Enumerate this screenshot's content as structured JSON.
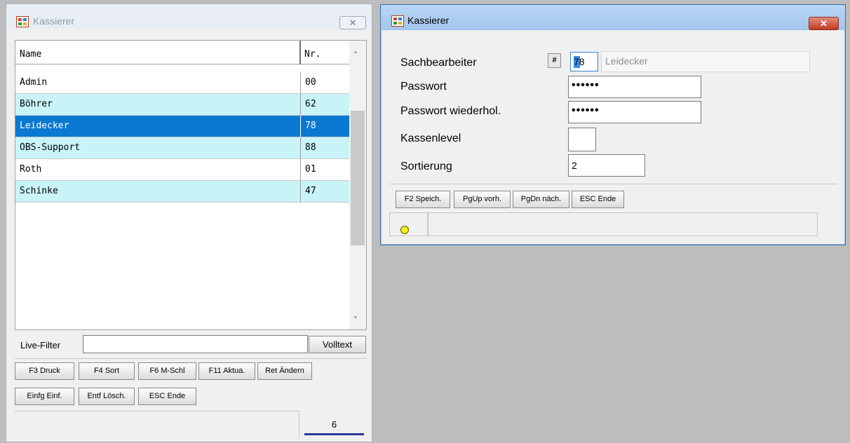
{
  "left_window": {
    "title": "Kassierer",
    "close_glyph": "✕",
    "list": {
      "columns": [
        "Name",
        "Nr."
      ],
      "rows": [
        {
          "name": "Admin",
          "nr": "00"
        },
        {
          "name": "Böhrer",
          "nr": "62"
        },
        {
          "name": "Leidecker",
          "nr": "78"
        },
        {
          "name": "OBS-Support",
          "nr": "88"
        },
        {
          "name": "Roth",
          "nr": "01"
        },
        {
          "name": "Schinke",
          "nr": "47"
        }
      ],
      "selected_index": 2,
      "scroll_up": "˄",
      "scroll_down": "˅"
    },
    "filter": {
      "label": "Live-Filter",
      "value": "",
      "button": "Volltext"
    },
    "buttons_row1": [
      "F3 Druck",
      "F4 Sort",
      "F6 M-Schl",
      "F11 Aktua.",
      "Ret Ändern"
    ],
    "buttons_row2": [
      "Einfg Einf.",
      "Entf Lösch.",
      "ESC Ende"
    ],
    "record_count": "6"
  },
  "right_window": {
    "title": "Kassierer",
    "close_glyph": "✕",
    "fields": {
      "sachbearbeiter_label": "Sachbearbeiter",
      "hash_button": "#",
      "nr_value": "78",
      "name_value": "Leidecker",
      "passwort_label": "Passwort",
      "passwort_value": "••••••",
      "passwort_wdh_label": "Passwort wiederhol.",
      "passwort_wdh_value": "••••••",
      "kassenlevel_label": "Kassenlevel",
      "kassenlevel_value": "",
      "sortierung_label": "Sortierung",
      "sortierung_value": "2"
    },
    "buttons": [
      "F2 Speich.",
      "PgUp vorh.",
      "PgDn näch.",
      "ESC Ende"
    ],
    "status_lamp_color": "#f7ec1a"
  }
}
